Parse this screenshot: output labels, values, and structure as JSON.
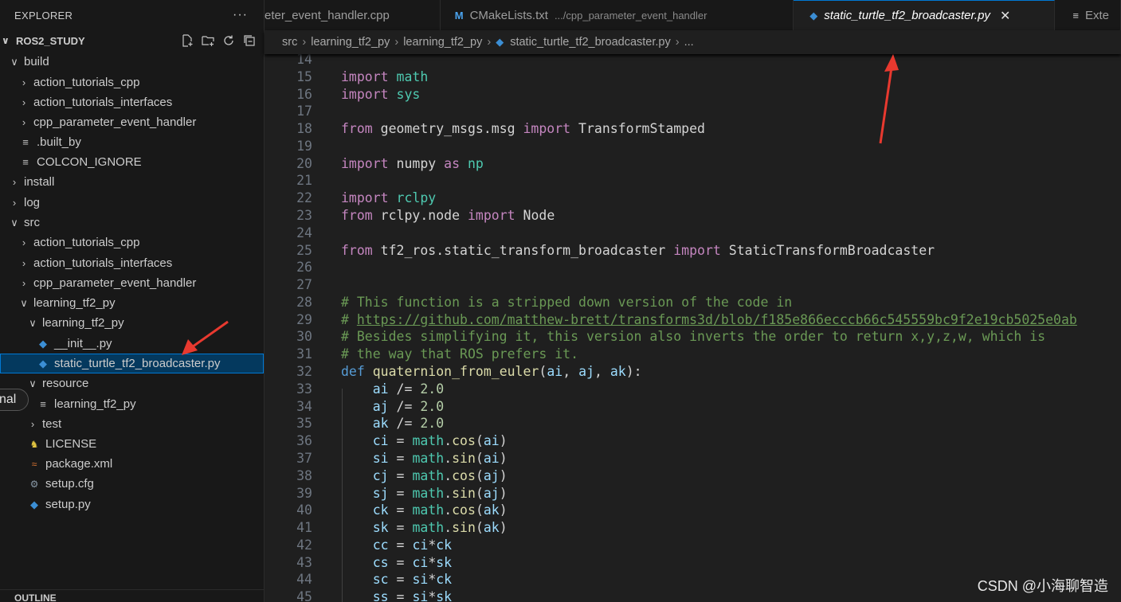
{
  "sidebar": {
    "title": "EXPLORER",
    "more": "···",
    "workspace": "ROS2_STUDY",
    "actions": [
      "new-file-icon",
      "new-folder-icon",
      "refresh-icon",
      "collapse-all-icon"
    ],
    "tree": [
      {
        "label": "build",
        "twisty": "∨",
        "icon": ""
      },
      {
        "label": "action_tutorials_cpp",
        "twisty": "›",
        "icon": ""
      },
      {
        "label": "action_tutorials_interfaces",
        "twisty": "›",
        "icon": ""
      },
      {
        "label": "cpp_parameter_event_handler",
        "twisty": "›",
        "icon": ""
      },
      {
        "label": ".built_by",
        "twisty": "",
        "icon": "lines"
      },
      {
        "label": "COLCON_IGNORE",
        "twisty": "",
        "icon": "lines"
      },
      {
        "label": "install",
        "twisty": "›",
        "icon": ""
      },
      {
        "label": "log",
        "twisty": "›",
        "icon": ""
      },
      {
        "label": "src",
        "twisty": "∨",
        "icon": ""
      },
      {
        "label": "action_tutorials_cpp",
        "twisty": "›",
        "icon": ""
      },
      {
        "label": "action_tutorials_interfaces",
        "twisty": "›",
        "icon": ""
      },
      {
        "label": "cpp_parameter_event_handler",
        "twisty": "›",
        "icon": ""
      },
      {
        "label": "learning_tf2_py",
        "twisty": "∨",
        "icon": ""
      },
      {
        "label": "learning_tf2_py",
        "twisty": "∨",
        "icon": ""
      },
      {
        "label": "__init__.py",
        "twisty": "",
        "icon": "python"
      },
      {
        "label": "static_turtle_tf2_broadcaster.py",
        "twisty": "",
        "icon": "python",
        "selected": true
      },
      {
        "label": "resource",
        "twisty": "∨",
        "icon": ""
      },
      {
        "label": "learning_tf2_py",
        "twisty": "",
        "icon": "lines"
      },
      {
        "label": "test",
        "twisty": "›",
        "icon": ""
      },
      {
        "label": "LICENSE",
        "twisty": "",
        "icon": "license"
      },
      {
        "label": "package.xml",
        "twisty": "",
        "icon": "rss"
      },
      {
        "label": "setup.cfg",
        "twisty": "",
        "icon": "gear"
      },
      {
        "label": "setup.py",
        "twisty": "",
        "icon": "python"
      }
    ],
    "outline_label": "OUTLINE",
    "pill_label": "nal"
  },
  "tabs": [
    {
      "label": "eter_event_handler.cpp",
      "path": "",
      "active": false
    },
    {
      "label": "CMakeLists.txt",
      "path": ".../cpp_parameter_event_handler",
      "active": false
    },
    {
      "label": "static_turtle_tf2_broadcaster.py",
      "path": "",
      "active": true
    },
    {
      "label": "Exte",
      "path": "",
      "active": false
    }
  ],
  "breadcrumb": [
    "src",
    "learning_tf2_py",
    "learning_tf2_py",
    "static_turtle_tf2_broadcaster.py",
    "..."
  ],
  "code_lines": [
    {
      "n": "14",
      "t": []
    },
    {
      "n": "15",
      "t": [
        [
          "kw",
          "import"
        ],
        [
          "plain",
          " "
        ],
        [
          "mod",
          "math"
        ]
      ]
    },
    {
      "n": "16",
      "t": [
        [
          "kw",
          "import"
        ],
        [
          "plain",
          " "
        ],
        [
          "mod",
          "sys"
        ]
      ]
    },
    {
      "n": "17",
      "t": []
    },
    {
      "n": "18",
      "t": [
        [
          "kw",
          "from"
        ],
        [
          "plain",
          " geometry_msgs.msg "
        ],
        [
          "kw",
          "import"
        ],
        [
          "plain",
          " TransformStamped"
        ]
      ]
    },
    {
      "n": "19",
      "t": []
    },
    {
      "n": "20",
      "t": [
        [
          "kw",
          "import"
        ],
        [
          "plain",
          " numpy "
        ],
        [
          "kw",
          "as"
        ],
        [
          "plain",
          " "
        ],
        [
          "mod",
          "np"
        ]
      ]
    },
    {
      "n": "21",
      "t": []
    },
    {
      "n": "22",
      "t": [
        [
          "kw",
          "import"
        ],
        [
          "plain",
          " "
        ],
        [
          "mod",
          "rclpy"
        ]
      ]
    },
    {
      "n": "23",
      "t": [
        [
          "kw",
          "from"
        ],
        [
          "plain",
          " rclpy.node "
        ],
        [
          "kw",
          "import"
        ],
        [
          "plain",
          " Node"
        ]
      ]
    },
    {
      "n": "24",
      "t": []
    },
    {
      "n": "25",
      "t": [
        [
          "kw",
          "from"
        ],
        [
          "plain",
          " tf2_ros.static_transform_broadcaster "
        ],
        [
          "kw",
          "import"
        ],
        [
          "plain",
          " StaticTransformBroadcaster"
        ]
      ]
    },
    {
      "n": "26",
      "t": []
    },
    {
      "n": "27",
      "t": []
    },
    {
      "n": "28",
      "t": [
        [
          "cm",
          "# This function is a stripped down version of the code in"
        ]
      ]
    },
    {
      "n": "29",
      "t": [
        [
          "cm",
          "# "
        ],
        [
          "url",
          "https://github.com/matthew-brett/transforms3d/blob/f185e866ecccb66c545559bc9f2e19cb5025e0ab"
        ]
      ]
    },
    {
      "n": "30",
      "t": [
        [
          "cm",
          "# Besides simplifying it, this version also inverts the order to return x,y,z,w, which is"
        ]
      ]
    },
    {
      "n": "31",
      "t": [
        [
          "cm",
          "# the way that ROS prefers it."
        ]
      ]
    },
    {
      "n": "32",
      "t": [
        [
          "kw2",
          "def"
        ],
        [
          "plain",
          " "
        ],
        [
          "fn",
          "quaternion_from_euler"
        ],
        [
          "plain",
          "("
        ],
        [
          "var",
          "ai"
        ],
        [
          "plain",
          ", "
        ],
        [
          "var",
          "aj"
        ],
        [
          "plain",
          ", "
        ],
        [
          "var",
          "ak"
        ],
        [
          "plain",
          "):"
        ]
      ]
    },
    {
      "n": "33",
      "t": [
        [
          "plain",
          "    "
        ],
        [
          "var",
          "ai"
        ],
        [
          "plain",
          " /= "
        ],
        [
          "num",
          "2.0"
        ]
      ]
    },
    {
      "n": "34",
      "t": [
        [
          "plain",
          "    "
        ],
        [
          "var",
          "aj"
        ],
        [
          "plain",
          " /= "
        ],
        [
          "num",
          "2.0"
        ]
      ]
    },
    {
      "n": "35",
      "t": [
        [
          "plain",
          "    "
        ],
        [
          "var",
          "ak"
        ],
        [
          "plain",
          " /= "
        ],
        [
          "num",
          "2.0"
        ]
      ]
    },
    {
      "n": "36",
      "t": [
        [
          "plain",
          "    "
        ],
        [
          "var",
          "ci"
        ],
        [
          "plain",
          " = "
        ],
        [
          "mod",
          "math"
        ],
        [
          "plain",
          "."
        ],
        [
          "fn",
          "cos"
        ],
        [
          "plain",
          "("
        ],
        [
          "var",
          "ai"
        ],
        [
          "plain",
          ")"
        ]
      ]
    },
    {
      "n": "37",
      "t": [
        [
          "plain",
          "    "
        ],
        [
          "var",
          "si"
        ],
        [
          "plain",
          " = "
        ],
        [
          "mod",
          "math"
        ],
        [
          "plain",
          "."
        ],
        [
          "fn",
          "sin"
        ],
        [
          "plain",
          "("
        ],
        [
          "var",
          "ai"
        ],
        [
          "plain",
          ")"
        ]
      ]
    },
    {
      "n": "38",
      "t": [
        [
          "plain",
          "    "
        ],
        [
          "var",
          "cj"
        ],
        [
          "plain",
          " = "
        ],
        [
          "mod",
          "math"
        ],
        [
          "plain",
          "."
        ],
        [
          "fn",
          "cos"
        ],
        [
          "plain",
          "("
        ],
        [
          "var",
          "aj"
        ],
        [
          "plain",
          ")"
        ]
      ]
    },
    {
      "n": "39",
      "t": [
        [
          "plain",
          "    "
        ],
        [
          "var",
          "sj"
        ],
        [
          "plain",
          " = "
        ],
        [
          "mod",
          "math"
        ],
        [
          "plain",
          "."
        ],
        [
          "fn",
          "sin"
        ],
        [
          "plain",
          "("
        ],
        [
          "var",
          "aj"
        ],
        [
          "plain",
          ")"
        ]
      ]
    },
    {
      "n": "40",
      "t": [
        [
          "plain",
          "    "
        ],
        [
          "var",
          "ck"
        ],
        [
          "plain",
          " = "
        ],
        [
          "mod",
          "math"
        ],
        [
          "plain",
          "."
        ],
        [
          "fn",
          "cos"
        ],
        [
          "plain",
          "("
        ],
        [
          "var",
          "ak"
        ],
        [
          "plain",
          ")"
        ]
      ]
    },
    {
      "n": "41",
      "t": [
        [
          "plain",
          "    "
        ],
        [
          "var",
          "sk"
        ],
        [
          "plain",
          " = "
        ],
        [
          "mod",
          "math"
        ],
        [
          "plain",
          "."
        ],
        [
          "fn",
          "sin"
        ],
        [
          "plain",
          "("
        ],
        [
          "var",
          "ak"
        ],
        [
          "plain",
          ")"
        ]
      ]
    },
    {
      "n": "42",
      "t": [
        [
          "plain",
          "    "
        ],
        [
          "var",
          "cc"
        ],
        [
          "plain",
          " = "
        ],
        [
          "var",
          "ci"
        ],
        [
          "plain",
          "*"
        ],
        [
          "var",
          "ck"
        ]
      ]
    },
    {
      "n": "43",
      "t": [
        [
          "plain",
          "    "
        ],
        [
          "var",
          "cs"
        ],
        [
          "plain",
          " = "
        ],
        [
          "var",
          "ci"
        ],
        [
          "plain",
          "*"
        ],
        [
          "var",
          "sk"
        ]
      ]
    },
    {
      "n": "44",
      "t": [
        [
          "plain",
          "    "
        ],
        [
          "var",
          "sc"
        ],
        [
          "plain",
          " = "
        ],
        [
          "var",
          "si"
        ],
        [
          "plain",
          "*"
        ],
        [
          "var",
          "ck"
        ]
      ]
    },
    {
      "n": "45",
      "t": [
        [
          "plain",
          "    "
        ],
        [
          "var",
          "ss"
        ],
        [
          "plain",
          " = "
        ],
        [
          "var",
          "si"
        ],
        [
          "plain",
          "*"
        ],
        [
          "var",
          "sk"
        ]
      ]
    }
  ],
  "watermark": "CSDN @小海聊智造",
  "colors": {
    "accent": "#0078d4",
    "annotation_arrow": "#e8392f",
    "selection": "#04395e"
  }
}
